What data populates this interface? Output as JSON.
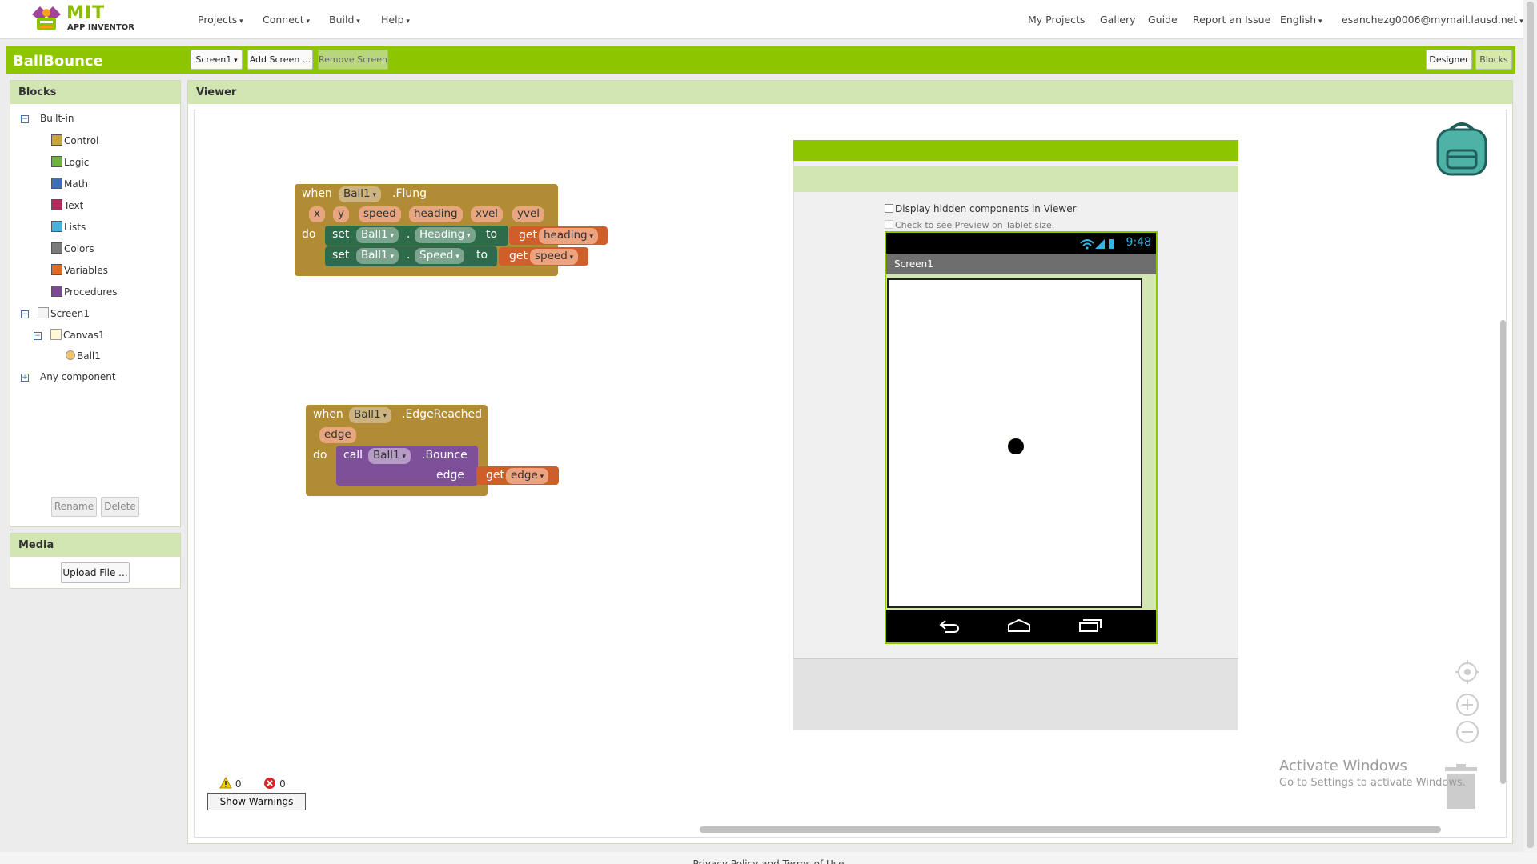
{
  "app": {
    "logo_text": "MIT",
    "logo_sub": "APP INVENTOR"
  },
  "nav": {
    "left": [
      "Projects",
      "Connect",
      "Build",
      "Help"
    ],
    "right": {
      "my_projects": "My Projects",
      "gallery": "Gallery",
      "guide": "Guide",
      "report": "Report an Issue",
      "language": "English",
      "account": "esanchezg0006@mymail.lausd.net"
    }
  },
  "project": {
    "name": "BallBounce",
    "screen_select": "Screen1",
    "add_screen": "Add Screen ...",
    "remove_screen": "Remove Screen",
    "designer": "Designer",
    "blocks": "Blocks"
  },
  "blocks_panel": {
    "title": "Blocks",
    "builtin": "Built-in",
    "categories": [
      {
        "label": "Control",
        "color": "#c8a43a"
      },
      {
        "label": "Logic",
        "color": "#6fb23e"
      },
      {
        "label": "Math",
        "color": "#3c6fb4"
      },
      {
        "label": "Text",
        "color": "#b2285a"
      },
      {
        "label": "Lists",
        "color": "#4ab1db"
      },
      {
        "label": "Colors",
        "color": "#7b7b7b"
      },
      {
        "label": "Variables",
        "color": "#e06a23"
      },
      {
        "label": "Procedures",
        "color": "#7b4a93"
      }
    ],
    "screen": "Screen1",
    "canvas": "Canvas1",
    "ball": "Ball1",
    "any_component": "Any component",
    "rename": "Rename",
    "delete": "Delete"
  },
  "media_panel": {
    "title": "Media",
    "upload": "Upload File ..."
  },
  "viewer": {
    "title": "Viewer",
    "display_hidden": "Display hidden components in Viewer",
    "tablet_preview": "Check to see Preview on Tablet size.",
    "clock": "9:48",
    "screen_title": "Screen1"
  },
  "flung_block": {
    "when": "when",
    "component": "Ball1",
    "event": ".Flung",
    "params": [
      "x",
      "y",
      "speed",
      "heading",
      "xvel",
      "yvel"
    ],
    "do": "do",
    "set1": {
      "set": "set",
      "comp": "Ball1",
      "dot": ".",
      "prop": "Heading",
      "to": "to",
      "get": "get",
      "var": "heading"
    },
    "set2": {
      "set": "set",
      "comp": "Ball1",
      "dot": ".",
      "prop": "Speed",
      "to": "to",
      "get": "get",
      "var": "speed"
    }
  },
  "edge_block": {
    "when": "when",
    "component": "Ball1",
    "event": ".EdgeReached",
    "param": "edge",
    "do": "do",
    "call": "call",
    "call_comp": "Ball1",
    "method": ".Bounce",
    "arg": "edge",
    "get": "get",
    "var": "edge"
  },
  "warnings": {
    "warn_count": "0",
    "error_count": "0",
    "show_warnings": "Show Warnings"
  },
  "watermark": {
    "line1": "Activate Windows",
    "line2": "Go to Settings to activate Windows."
  },
  "footer": "Privacy Policy and Terms of Use",
  "colors": {
    "brand_green": "#8dc500",
    "control_block": "#b18c35",
    "set_block": "#2e6b4b",
    "get_block": "#d05e2b",
    "call_block": "#7e509a"
  }
}
